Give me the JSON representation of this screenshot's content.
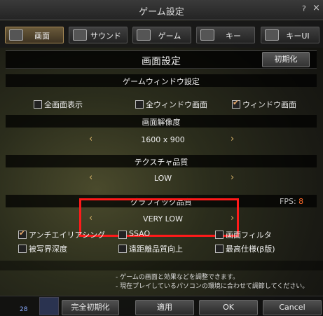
{
  "window": {
    "title": "ゲーム設定",
    "help": "?",
    "close": "×"
  },
  "tabs": [
    {
      "label": "画面",
      "active": true
    },
    {
      "label": "サウンド"
    },
    {
      "label": "ゲーム"
    },
    {
      "label": "キー"
    },
    {
      "label": "キーUI"
    }
  ],
  "panel": {
    "title": "画面設定",
    "reset_label": "初期化"
  },
  "game_window": {
    "header": "ゲームウィンドウ設定",
    "options": [
      {
        "label": "全画面表示",
        "checked": false
      },
      {
        "label": "全ウィンドウ画面",
        "checked": false
      },
      {
        "label": "ウィンドウ画面",
        "checked": true
      }
    ]
  },
  "resolution": {
    "header": "画面解像度",
    "value": "1600 x 900"
  },
  "texture": {
    "header": "テクスチャ品質",
    "value": "LOW"
  },
  "graphics": {
    "header": "グラフィック品質",
    "value": "VERY LOW",
    "fps_label": "FPS:",
    "fps_value": "8"
  },
  "effects": [
    {
      "label": "アンチエイリアシング",
      "checked": true
    },
    {
      "label": "SSAO",
      "checked": false
    },
    {
      "label": "画面フィルタ",
      "checked": false
    },
    {
      "label": "被写界深度",
      "checked": false
    },
    {
      "label": "遠距離品質向上",
      "checked": false
    },
    {
      "label": "最高仕様(β版)",
      "checked": false
    }
  ],
  "notes": [
    "- ゲームの画面と効果などを調整できます。",
    "- 現在プレイしているパソコンの環境に合わせて調節してください。"
  ],
  "footer": {
    "level": "28",
    "buttons": [
      "完全初期化",
      "適用",
      "OK",
      "Cancel"
    ]
  },
  "colors": {
    "accent": "#d9b56a",
    "highlight": "#ff1a1a",
    "fps": "#ff6a2a"
  }
}
